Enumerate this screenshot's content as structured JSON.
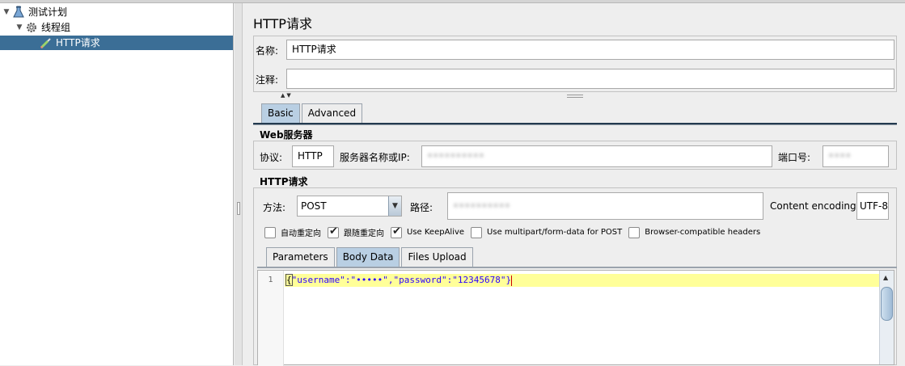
{
  "tree": {
    "items": [
      {
        "label": "测试计划",
        "icon": "test-plan-flask-icon",
        "toggle": "▼"
      },
      {
        "label": "线程组",
        "icon": "thread-group-gear-icon",
        "toggle": "▼"
      },
      {
        "label": "HTTP请求",
        "icon": "http-sampler-pipette-icon",
        "toggle": ""
      }
    ]
  },
  "panel": {
    "title": "HTTP请求",
    "name_label": "名称:",
    "name_value": "HTTP请求",
    "comment_label": "注释:",
    "comment_value": "",
    "tabs": [
      "Basic",
      "Advanced"
    ],
    "web_server": {
      "heading": "Web服务器",
      "protocol_label": "协议:",
      "protocol_value": "HTTP",
      "server_label": "服务器名称或IP:",
      "server_value": "••••••••••",
      "port_label": "端口号:",
      "port_value": "••••"
    },
    "http_request": {
      "heading": "HTTP请求",
      "method_label": "方法:",
      "method_value": "POST",
      "path_label": "路径:",
      "path_value": "••••••••••",
      "encoding_label": "Content encoding:",
      "encoding_value": "UTF-8"
    },
    "checkboxes": [
      {
        "label": "自动重定向",
        "checked": false
      },
      {
        "label": "跟随重定向",
        "checked": true
      },
      {
        "label": "Use KeepAlive",
        "checked": true
      },
      {
        "label": "Use multipart/form-data for POST",
        "checked": false
      },
      {
        "label": "Browser-compatible headers",
        "checked": false
      }
    ],
    "body_tabs": [
      "Parameters",
      "Body Data",
      "Files Upload"
    ],
    "editor": {
      "line_number": "1",
      "code_open": "{",
      "code_body": "\"username\":\"•••••\",\"password\":\"12345678\"",
      "code_close": "}"
    }
  },
  "colors": {
    "selection": "#3b6e96",
    "active_tab": "#b9cfe3",
    "current_line": "#ffff99",
    "code_text": "#2a00ff"
  }
}
